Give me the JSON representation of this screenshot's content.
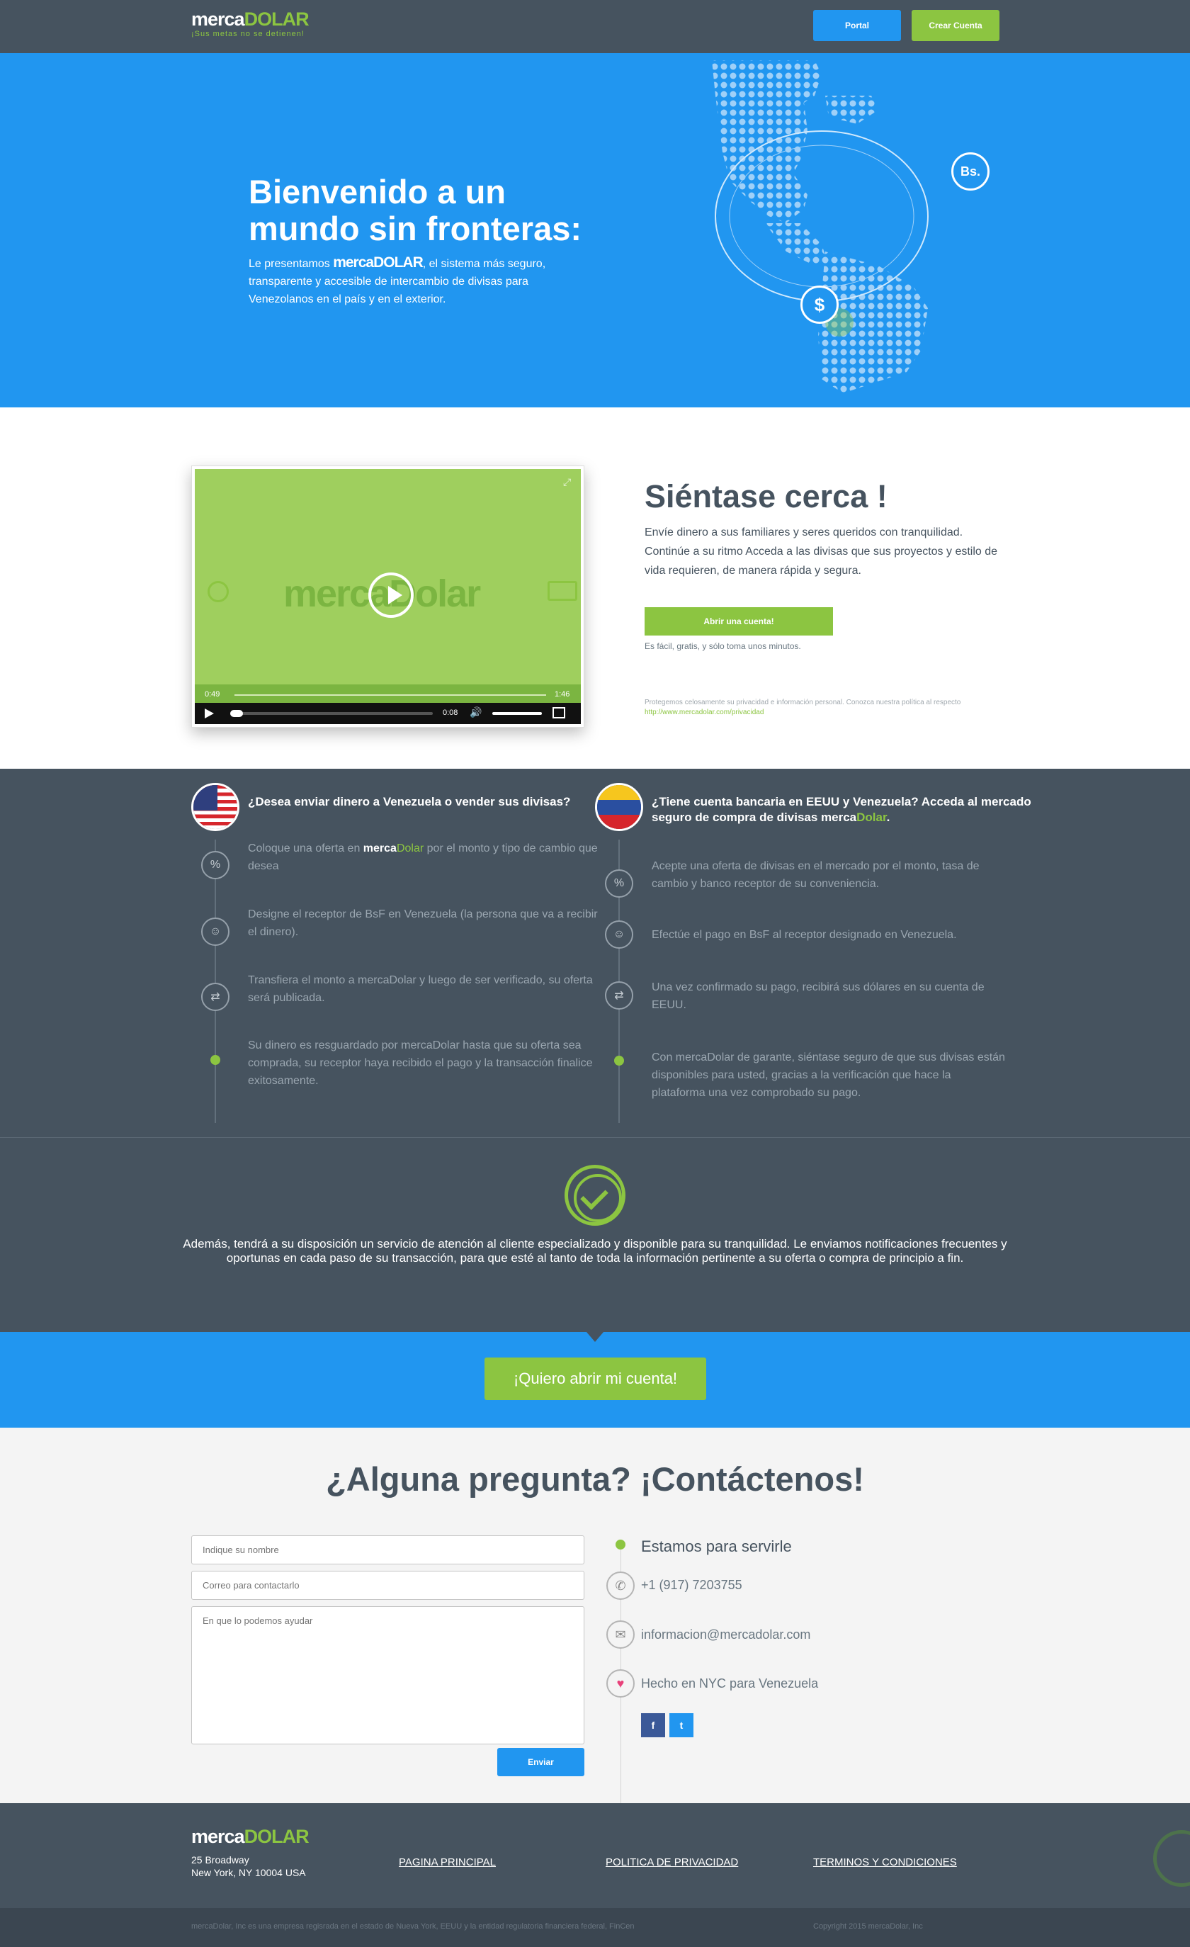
{
  "header": {
    "logo_part1": "merca",
    "logo_part2": "DOLAR",
    "tagline": "¡Sus metas no se detienen!",
    "portal_label": "Portal",
    "create_account_label": "Crear Cuenta",
    "colors": {
      "bar": "#46535f",
      "portal": "#2196f0",
      "create": "#8cc541"
    }
  },
  "hero": {
    "title_line1": "Bienvenido a un",
    "title_line2": "mundo sin fronteras:",
    "intro_before": "Le presentamos",
    "intro_logo_part1": "merca",
    "intro_logo_part2": "DOLAR",
    "intro_after": ", el sistema más seguro, transparente y accesible de intercambio de divisas para Venezolanos en el país y en el exterior.",
    "badge_bs": "Bs.",
    "badge_dollar": "$"
  },
  "video_section": {
    "video_logo_part1": "merca",
    "video_logo_part2": "Dolar",
    "time_elapsed": "0:49",
    "time_total": "1:46",
    "time_current": "0:08",
    "heading": "Siéntase cerca !",
    "body": "Envíe dinero a sus familiares y seres queridos con tranquilidad. Continúe a su ritmo Acceda a las divisas que sus proyectos y estilo de vida requieren, de manera rápida y segura.",
    "open_account_label": "Abrir una cuenta!",
    "note": "Es fácil, gratis, y sólo toma unos minutos.",
    "privacy_text": "Protegemos celosamente su privacidad e información personal. Conozca nuestra política al respecto",
    "privacy_link": "http://www.mercadolar.com/privacidad"
  },
  "steps": {
    "left": {
      "title": "¿Desea enviar dinero a Venezuela o vender sus divisas?",
      "step1_before": "Coloque una oferta en",
      "step1_brand1": "merca",
      "step1_brand2": "Dolar",
      "step1_after": "por el monto y tipo de cambio que desea",
      "step2": "Designe el receptor de BsF en Venezuela (la persona que va a recibir el dinero).",
      "step3": "Transfiera el monto a mercaDolar y luego de ser verificado, su oferta será publicada.",
      "step4": "Su dinero es resguardado por mercaDolar hasta que su oferta sea comprada, su receptor haya recibido el pago y la transacción finalice exitosamente."
    },
    "right": {
      "title_before": "¿Tiene cuenta bancaria en EEUU y Venezuela? Acceda al mercado seguro de compra de divisas merca",
      "title_brand": "Dolar",
      "title_end": ".",
      "step1": "Acepte una oferta de divisas en el mercado por el monto, tasa de cambio y banco receptor de su conveniencia.",
      "step2": "Efectúe el pago en BsF al receptor designado en Venezuela.",
      "step3": "Una vez confirmado su pago, recibirá sus dólares en su cuenta de EEUU.",
      "step4": "Con mercaDolar de garante, siéntase seguro de que sus divisas están disponibles para usted, gracias a la verificación que hace la plataforma una vez comprobado su pago."
    }
  },
  "assurance": {
    "text": "Además, tendrá a su disposición un servicio de atención al cliente especializado y disponible para su tranquilidad. Le enviamos notificaciones frecuentes y oportunas en cada paso de su transacción, para que esté al tanto de toda la información pertinente a su oferta o compra de principio a fin."
  },
  "cta": {
    "label": "¡Quiero abrir mi cuenta!"
  },
  "contact": {
    "heading": "¿Alguna pregunta? ¡Contáctenos!",
    "name_placeholder": "Indique su nombre",
    "email_placeholder": "Correo para contactarlo",
    "message_placeholder": "En que lo podemos ayudar",
    "send_label": "Enviar",
    "serve_text": "Estamos para servirle",
    "phone": "+1 (917) 7203755",
    "email": "informacion@mercadolar.com",
    "made_in": "Hecho en NYC para Venezuela",
    "facebook": "f",
    "twitter": "t"
  },
  "footer": {
    "logo_part1": "merca",
    "logo_part2": "DOLAR",
    "address1": "25 Broadway",
    "address2": "New York, NY 10004 USA",
    "link_home": "PAGINA PRINCIPAL",
    "link_privacy": "POLITICA DE PRIVACIDAD",
    "link_terms": "TERMINOS Y CONDICIONES",
    "legal": "mercaDolar, Inc es una empresa regisrada en el estado de Nueva York, EEUU y la entidad regulatoria financiera federal, FinCen",
    "copyright": "Copyright 2015 mercaDolar, Inc"
  }
}
